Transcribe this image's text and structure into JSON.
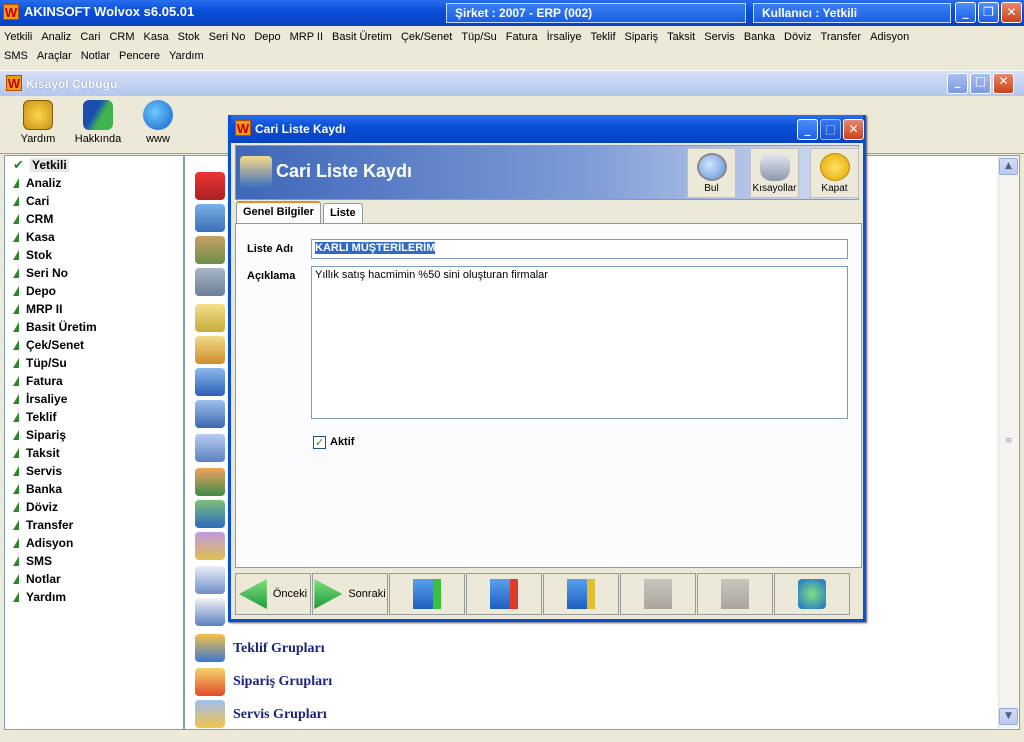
{
  "app": {
    "title": "AKINSOFT Wolvox s6.05.01",
    "company": "Şirket : 2007 - ERP (002)",
    "user": "Kullanıcı : Yetkili",
    "logo_letter": "W"
  },
  "window_controls": {
    "minimize": "_",
    "maximize": "□",
    "restore": "❐",
    "close": "✕"
  },
  "menu": {
    "row1": [
      "Yetkili",
      "Analiz",
      "Cari",
      "CRM",
      "Kasa",
      "Stok",
      "Seri No",
      "Depo",
      "MRP II",
      "Basit Üretim",
      "Çek/Senet",
      "Tüp/Su",
      "Fatura",
      "İrsaliye",
      "Teklif",
      "Sipariş",
      "Taksit",
      "Servis",
      "Banka",
      "Döviz",
      "Transfer",
      "Adisyon"
    ],
    "row2": [
      "SMS",
      "Araçlar",
      "Notlar",
      "Pencere",
      "Yardım"
    ]
  },
  "shortcut_window": {
    "title": "Kısayol Çubuğu",
    "tools": [
      {
        "label": "Yardım",
        "icon": "help-icon"
      },
      {
        "label": "Hakkında",
        "icon": "about-icon"
      },
      {
        "label": "www",
        "icon": "globe-icon"
      }
    ]
  },
  "left_list": {
    "items": [
      "Yetkili",
      "Analiz",
      "Cari",
      "CRM",
      "Kasa",
      "Stok",
      "Seri No",
      "Depo",
      "MRP II",
      "Basit Üretim",
      "Çek/Senet",
      "Tüp/Su",
      "Fatura",
      "İrsaliye",
      "Teklif",
      "Sipariş",
      "Taksit",
      "Servis",
      "Banka",
      "Döviz",
      "Transfer",
      "Adisyon",
      "SMS",
      "Notlar",
      "Yardım"
    ],
    "selected": "Yetkili"
  },
  "right_panel": {
    "groups": [
      "Teklif Grupları",
      "Sipariş Grupları",
      "Servis Grupları"
    ]
  },
  "dialog": {
    "title": "Cari Liste Kaydı",
    "header_title": "Cari Liste Kaydı",
    "header_buttons": [
      {
        "label": "Bul",
        "icon": "search-icon"
      },
      {
        "label": "Kısayollar",
        "icon": "shortcuts-icon"
      },
      {
        "label": "Kapat",
        "icon": "exit-icon"
      }
    ],
    "tabs": [
      "Genel Bilgiler",
      "Liste"
    ],
    "active_tab": "Genel Bilgiler",
    "form": {
      "list_name_label": "Liste Adı",
      "list_name_value": "KARLI MÜŞTERİLERİM",
      "description_label": "Açıklama",
      "description_value": "Yıllık satış hacmimin %50 sini oluşturan firmalar",
      "active_label": "Aktif",
      "active_checked": true
    },
    "nav_buttons": [
      {
        "label": "Önceki",
        "icon": "previous-icon",
        "enabled": true
      },
      {
        "label": "Sonraki",
        "icon": "next-icon",
        "enabled": true
      },
      {
        "label": "",
        "icon": "add-record-icon",
        "enabled": true
      },
      {
        "label": "",
        "icon": "delete-record-icon",
        "enabled": true
      },
      {
        "label": "",
        "icon": "edit-record-icon",
        "enabled": true
      },
      {
        "label": "",
        "icon": "save-record-icon",
        "enabled": false
      },
      {
        "label": "",
        "icon": "cancel-record-icon",
        "enabled": false
      },
      {
        "label": "",
        "icon": "refresh-icon",
        "enabled": true
      }
    ]
  },
  "colors": {
    "titlebar": "#0a4fd8",
    "accent": "#e68b2c",
    "list_green": "#2a8a2a",
    "group_text": "#1a237e"
  }
}
